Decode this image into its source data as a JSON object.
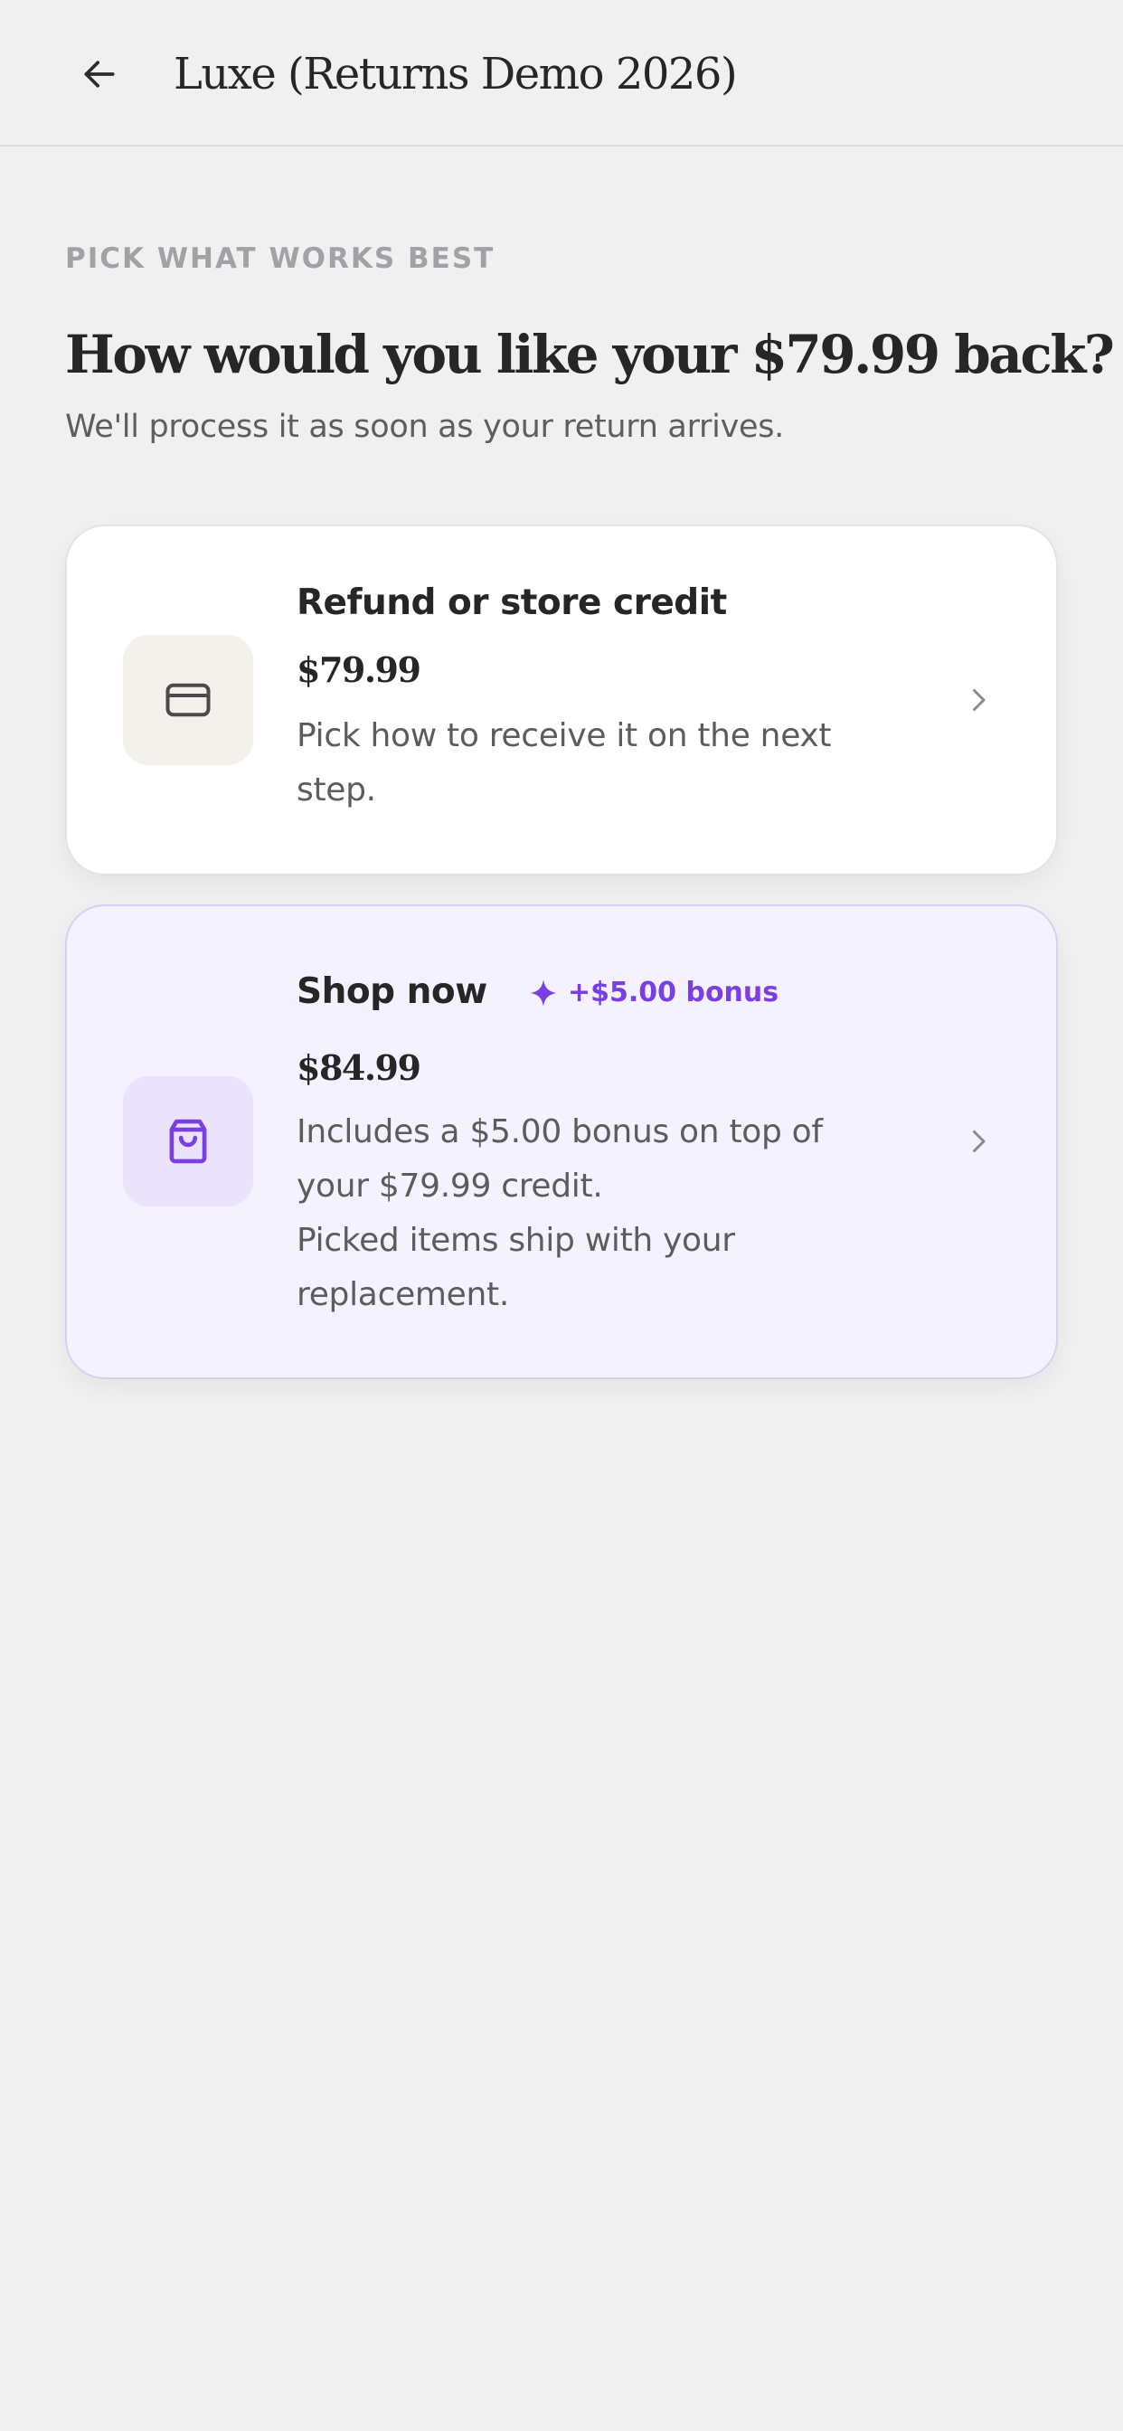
{
  "header": {
    "title": "Luxe (Returns Demo 2026)",
    "back_icon": "arrow-left-icon"
  },
  "intro": {
    "eyebrow": "PICK WHAT WORKS BEST",
    "headline": "How would you like your $79.99 back?",
    "subhead": "We'll process it as soon as your return arrives."
  },
  "options": [
    {
      "title": "Refund or store credit",
      "price": "$79.99",
      "description_lines": [
        "Pick how to receive it on the next",
        "step."
      ],
      "icon": "credit-card-icon",
      "chevron_icon": "chevron-right-icon"
    },
    {
      "title": "Shop now",
      "badge": "+$5.00 bonus",
      "badge_icon": "sparkle-icon",
      "price": "$84.99",
      "description_lines": [
        "Includes a $5.00 bonus on top of",
        "your $79.99 credit.",
        "Picked items ship with your",
        "replacement."
      ],
      "icon": "shopping-bag-icon",
      "chevron_icon": "chevron-right-icon"
    }
  ],
  "colors": {
    "background": "#f0f0f0",
    "accent": "#7a3fe4",
    "shop_card_bg": "#f4f2fe",
    "refund_icon_tile": "#f4f0ec",
    "shop_icon_tile": "#ebe2fb"
  }
}
